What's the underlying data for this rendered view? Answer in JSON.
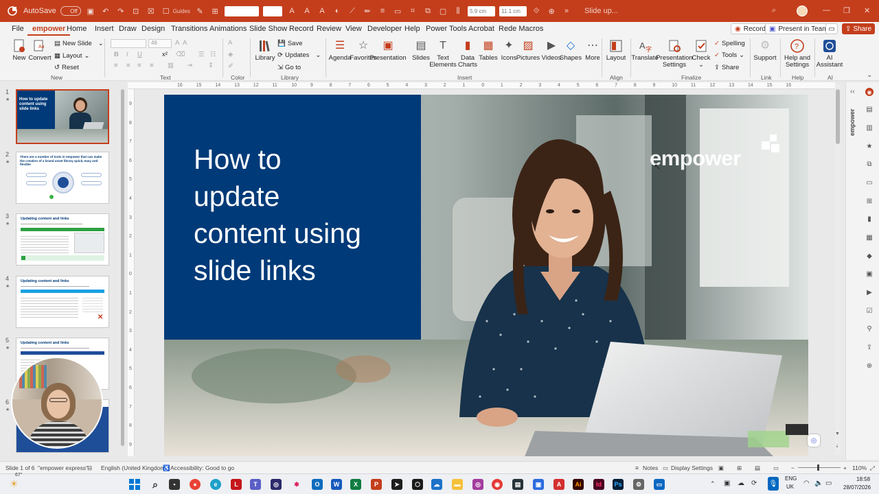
{
  "titlebar": {
    "autosave_label": "AutoSave",
    "autosave_state": "Off",
    "guides_label": "Guides",
    "width_value": "5.9 cm",
    "height_value": "11.1 cm",
    "doc_title": "Slide up...",
    "brand_color": "#c43e1c"
  },
  "menu": {
    "tabs": [
      "File",
      "empower",
      "Home",
      "Insert",
      "Draw",
      "Design",
      "Transitions",
      "Animations",
      "Slide Show",
      "Record",
      "Review",
      "View",
      "Developer",
      "Help",
      "Power Tools",
      "Acrobat",
      "Rede Macros"
    ],
    "active_tab": "empower",
    "record_label": "Record",
    "present_label": "Present in Teams",
    "share_label": "Share"
  },
  "ribbon": {
    "new_label": "New",
    "convert_label": "Convert",
    "new_slide_label": "New Slide",
    "layout_label": "Layout",
    "reset_label": "Reset",
    "font_size_value": "46",
    "library_label": "Library",
    "save_label": "Save",
    "updates_label": "Updates",
    "goto_label": "Go to",
    "insert_items": [
      "Agenda",
      "Favorites",
      "Presentation",
      "Slides",
      "Text Elements",
      "Data Charts",
      "Tables",
      "Icons",
      "Pictures",
      "Videos",
      "Shapes",
      "More"
    ],
    "layout_btn_label": "Layout",
    "translate_label": "Translate",
    "pres_settings_label": "Presentation Settings",
    "check_label": "Check",
    "spelling_label": "Spelling",
    "tools_label": "Tools",
    "share_small_label": "Share",
    "support_label": "Support",
    "help_label": "Help and Settings",
    "ai_label": "AI Assistant",
    "groups": {
      "new": "New",
      "text": "Text",
      "color": "Color",
      "library": "Library",
      "insert": "Insert",
      "align": "Align",
      "finalize": "Finalize",
      "link": "Link",
      "help": "Help",
      "ai": "AI"
    }
  },
  "ruler": {
    "h_ticks": [
      "16",
      "15",
      "14",
      "13",
      "12",
      "11",
      "10",
      "9",
      "8",
      "7",
      "6",
      "5",
      "4",
      "3",
      "2",
      "1",
      "0",
      "1",
      "2",
      "3",
      "4",
      "5",
      "6",
      "7",
      "8",
      "9",
      "10",
      "11",
      "12",
      "13",
      "14",
      "15",
      "16"
    ],
    "v_ticks": [
      "9",
      "8",
      "7",
      "6",
      "5",
      "4",
      "3",
      "2",
      "1",
      "0",
      "1",
      "2",
      "3",
      "4",
      "5",
      "6",
      "7",
      "8",
      "9"
    ]
  },
  "thumbnails": [
    {
      "num": "1",
      "title": "How to update content using slide links"
    },
    {
      "num": "2",
      "title": "There are a number of tools in empower that can make the creation of a brand asset library quick, easy and flexible"
    },
    {
      "num": "3",
      "title": "Updating content and links"
    },
    {
      "num": "4",
      "title": "Updating content and links"
    },
    {
      "num": "5",
      "title": "Updating content and links"
    },
    {
      "num": "6",
      "title": ""
    }
  ],
  "slide": {
    "title_lines": [
      "How to",
      "update",
      "content using",
      "slide links"
    ],
    "logo_text": "empower",
    "panel_color": "#003a78"
  },
  "side_panel": {
    "label": "empower"
  },
  "status": {
    "slide_of": "Slide 1 of 6",
    "theme": "\"empower express\"",
    "language": "English (United Kingdom)",
    "accessibility": "Accessibility: Good to go",
    "notes_label": "Notes",
    "display_label": "Display Settings",
    "zoom": "110%"
  },
  "taskbar": {
    "weather_temp": "67°",
    "lang_top": "ENG",
    "lang_bottom": "UK",
    "time": "18:58",
    "date": "28/07/2026"
  }
}
